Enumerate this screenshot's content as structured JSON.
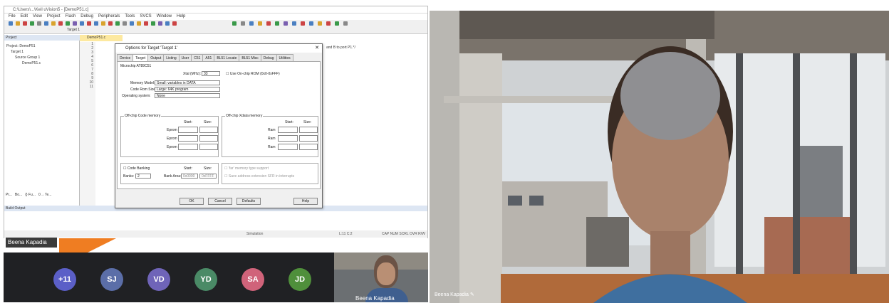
{
  "ide": {
    "title": "C:\\Users\\...\\Keil uVision5 - [DemoP51.c]",
    "menu": [
      "File",
      "Edit",
      "View",
      "Project",
      "Flash",
      "Debug",
      "Peripherals",
      "Tools",
      "SVCS",
      "Window",
      "Help"
    ],
    "target_select": "Target 1",
    "project_panel_title": "Project",
    "tree": [
      "Project: DemoP51",
      "Target 1",
      "Source Group 1",
      "DemoP51.c"
    ],
    "editor_tab": "DemoP51.c",
    "line_numbers": [
      "1",
      "2",
      "3",
      "4",
      "5",
      "6",
      "7",
      "8",
      "9",
      "10",
      "11"
    ],
    "code_comment": "and B to port P1.*/",
    "build_output_title": "Build Output",
    "status_left": "Simulation",
    "status_mid": "L:11 C:2",
    "status_right": "CAP NUM SCRL OVR R/W",
    "bottom_tabs": [
      "Pr...",
      "Bo...",
      "{} Fu...",
      "0→ Te..."
    ]
  },
  "dialog": {
    "title": "Options for Target 'Target 1'",
    "tabs": [
      "Device",
      "Target",
      "Output",
      "Listing",
      "User",
      "C51",
      "A51",
      "BL51 Locate",
      "BL51 Misc",
      "Debug",
      "Utilities"
    ],
    "active_tab": "Target",
    "device": "Microchip AT89C51",
    "xtal_label": "Xtal (MHz):",
    "xtal_value": "33",
    "use_onchip_rom": "Use On-chip ROM (0x0-0xFFF)",
    "memory_model_label": "Memory Model:",
    "memory_model": "Small: variables in DATA",
    "code_rom_label": "Code Rom Size:",
    "code_rom": "Large: 64K program",
    "os_label": "Operating system:",
    "os": "None",
    "offchip_code": "Off-chip Code memory",
    "offchip_xdata": "Off-chip Xdata memory",
    "start": "Start:",
    "size": "Size:",
    "eprom": "Eprom",
    "ram": "Ram",
    "code_banking": "Code Banking",
    "banks_label": "Banks:",
    "banks": "2",
    "bank_area": "Bank Area:",
    "bank_start": "0x0000",
    "bank_end": "0xFFFF",
    "far_memory": "'far' memory type support",
    "save_address": "Save address extension SFR in interrupts",
    "ok": "OK",
    "cancel": "Cancel",
    "defaults": "Defaults",
    "help": "Help"
  },
  "meeting": {
    "presenter_name": "Beena Kapadia",
    "participants": [
      {
        "initials": "+11",
        "color": "#5b5fc7"
      },
      {
        "initials": "SJ",
        "color": "#5b6ea8"
      },
      {
        "initials": "VD",
        "color": "#6f64b8"
      },
      {
        "initials": "YD",
        "color": "#4a8a66"
      },
      {
        "initials": "SA",
        "color": "#d0637a"
      },
      {
        "initials": "JD",
        "color": "#4f8f3b"
      }
    ],
    "thumb_name": "Beena Kapadia",
    "camera_name": "Beena Kapadia"
  }
}
